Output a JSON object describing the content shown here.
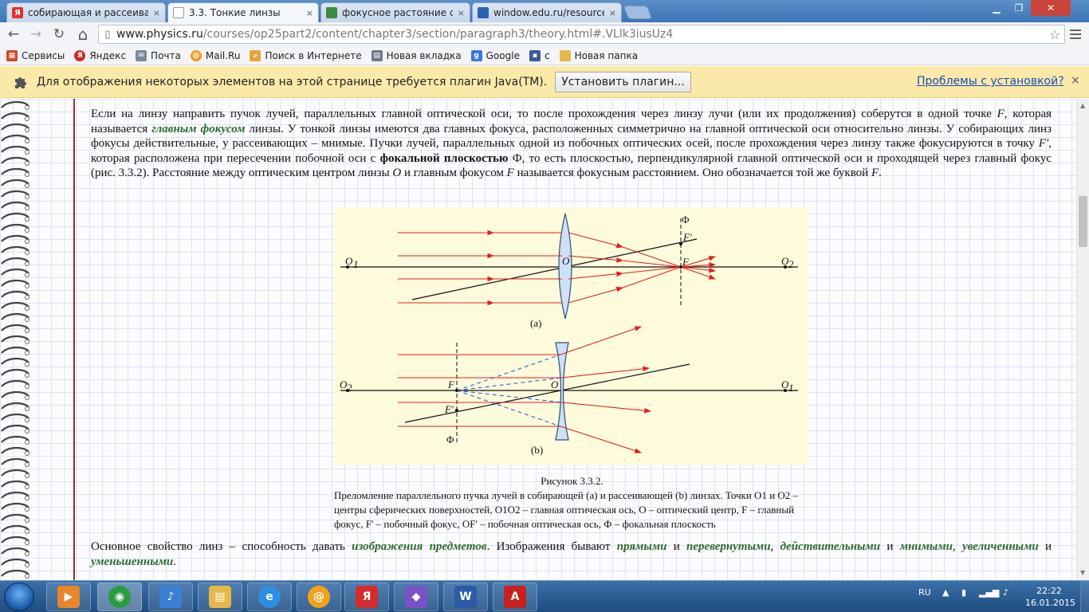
{
  "tabs": [
    {
      "title": "собирающая и рассеива",
      "close": "×",
      "favicon": "Я",
      "color": "#e0312c"
    },
    {
      "title": "3.3. Тонкие линзы",
      "close": "×",
      "favicon": "",
      "color": "#ffffff"
    },
    {
      "title": "фокусное растояние соб",
      "close": "×",
      "favicon": "",
      "color": "#3c8a3c"
    },
    {
      "title": "window.edu.ru/resource/",
      "close": "×",
      "favicon": "",
      "color": "#2a61b0"
    }
  ],
  "window_controls": {
    "minimize": "▁",
    "restore": "❐",
    "close": "✕"
  },
  "nav": {
    "back": "←",
    "forward": "→",
    "reload": "↻",
    "home": "⌂"
  },
  "address": {
    "host": "www.physics.ru",
    "path": "/courses/op25part2/content/chapter3/section/paragraph3/theory.html#.VLlk3iusUz4",
    "star": "☆"
  },
  "bookmarks": [
    {
      "label": "Сервисы",
      "icon": "apps-icon",
      "color": "#d04a2a"
    },
    {
      "label": "Яндекс",
      "icon": "yandex-icon",
      "color": "#cc2a2a"
    },
    {
      "label": "Почта",
      "icon": "mail-icon",
      "color": "#7a8a9a"
    },
    {
      "label": "Mail.Ru",
      "icon": "mailru-icon",
      "color": "#f29a1a"
    },
    {
      "label": "Поиск в Интернете",
      "icon": "search-icon",
      "color": "#e8a23a"
    },
    {
      "label": "Новая вкладка",
      "icon": "page-icon",
      "color": "#6a7a8a"
    },
    {
      "label": "Google",
      "icon": "google-icon",
      "color": "#3a77e0"
    },
    {
      "label": "с",
      "icon": "chat-icon",
      "color": "#3a5a9a"
    },
    {
      "label": "Новая папка",
      "icon": "folder-icon",
      "color": "#e2b94a"
    }
  ],
  "infobar": {
    "message": "Для отображения некоторых элементов на этой странице требуется плагин Java(TM).",
    "install_button": "Установить плагин...",
    "trouble_link": "Проблемы с установкой?",
    "close": "×"
  },
  "content": {
    "para1": {
      "t1": "Если на линзу направить пучок лучей, параллельных главной оптической оси, то после прохождения через линзу лучи (или их продолжения) соберутся в одной точке ",
      "F": "F",
      "t2": ", которая называется ",
      "main_focus": "главным фокусом",
      "t3": " линзы. У тонкой линзы имеются два главных фокуса, расположенных симметрично на главной оптической оси относительно линзы. У собирающих линз фокусы действительные, у рассеивающих – мнимые. Пучки лучей, параллельных одной из побочных оптических осей, после прохождения через линзу также фокусируются в точку ",
      "Fprime": "F'",
      "t4": ", которая расположена при пересечении побочной оси с ",
      "focal_plane": "фокальной плоскостью",
      "t5": " Ф, то есть плоскостью, перпендикулярной главной оптической оси и проходящей через главный фокус (рис. 3.3.2). Расстояние между оптическим центром линзы ",
      "O": "O",
      "t6": " и главным фокусом ",
      "F2": "F",
      "t7": " называется фокусным расстоянием. Оно обозначается той же буквой ",
      "F3": "F",
      "t8": "."
    },
    "figure_labels": {
      "a": "(a)",
      "b": "(b)",
      "O1": "O",
      "O2": "O",
      "sub1": "1",
      "sub2": "2",
      "O": "O",
      "F": "F",
      "Fprime": "F'",
      "Phi": "Φ"
    },
    "caption": {
      "number": "Рисунок 3.3.2.",
      "text": "Преломление параллельного пучка лучей в собирающей (a) и рассеивающей (b) линзах. Точки O1 и O2 – центры сферических поверхностей, O1O2 – главная оптическая ось, O – оптический центр, F – главный фокус, F' – побочный фокус, OF' – побочная оптическая ось, Ф – фокальная плоскость"
    },
    "para2": {
      "t1": "Основное свойство линз – способность давать ",
      "images": "изображения предметов",
      "t2": ". Изображения бывают ",
      "direct": "прямыми",
      "t3": " и ",
      "inverted": "перевернутыми",
      "t4": ", ",
      "real": "действительными",
      "t5": " и ",
      "imaginary": "мнимыми",
      "t6": ", ",
      "enlarged": "увеличенными",
      "t7": " и ",
      "reduced": "уменьшенными",
      "t8": "."
    }
  },
  "scrollbar": {
    "up": "▲",
    "down": "▼"
  },
  "taskbar": {
    "items": [
      {
        "name": "media-player",
        "color": "#e8862a",
        "glyph": "▶"
      },
      {
        "name": "chrome",
        "color": "#2b9b3f",
        "glyph": "◉"
      },
      {
        "name": "speaker",
        "color": "#3c7fd4",
        "glyph": "♪"
      },
      {
        "name": "explorer",
        "color": "#e6b84a",
        "glyph": "▤"
      },
      {
        "name": "internet-explorer",
        "color": "#2f8ee0",
        "glyph": "e"
      },
      {
        "name": "mail-agent",
        "color": "#f2a21c",
        "glyph": "@"
      },
      {
        "name": "yandex-browser",
        "color": "#d42c2c",
        "glyph": "Я"
      },
      {
        "name": "visual-studio",
        "color": "#7a52c8",
        "glyph": "◆"
      },
      {
        "name": "word",
        "color": "#2b5ba8",
        "glyph": "W"
      },
      {
        "name": "acrobat",
        "color": "#c6201f",
        "glyph": "A"
      }
    ],
    "lang": "RU",
    "time": "22:22",
    "date": "16.01.2015"
  }
}
